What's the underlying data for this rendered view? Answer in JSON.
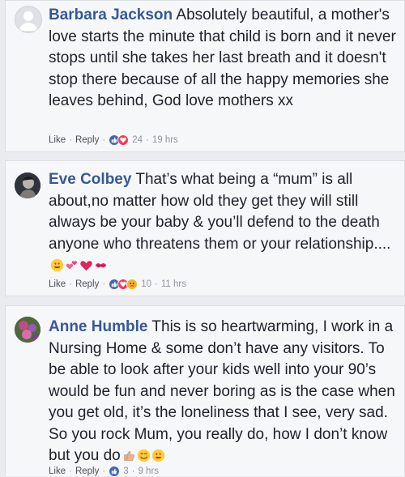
{
  "comments": [
    {
      "author": "Barbara Jackson",
      "text": "Absolutely beautiful, a mother's love starts the minute that child is born and it never stops until she takes her last breath and it doesn't stop there because of all the happy memories she leaves behind, God love mothers xx",
      "like": "Like",
      "reply": "Reply",
      "count": "24",
      "time": "19 hrs",
      "reactions": [
        "like-reaction-icon",
        "love-reaction-icon"
      ]
    },
    {
      "author": "Eve Colbey",
      "text": "That’s what being a “mum” is all about,no matter how old they get they will still always be your baby & you’ll defend to the death anyone who threatens them or your relationship....",
      "emojis": [
        "heart-eyes-emoji",
        "two-hearts-emoji",
        "red-heart-emoji",
        "kiss-mark-emoji"
      ],
      "like": "Like",
      "reply": "Reply",
      "count": "10",
      "time": "11 hrs",
      "reactions": [
        "like-reaction-icon",
        "love-reaction-icon",
        "sad-reaction-icon"
      ]
    },
    {
      "author": "Anne Humble",
      "text": "This is so heartwarming, I work in a Nursing Home & some don’t have any visitors. To be able to look after your kids well into your 90’s would be fun and never boring as is the case when you get old, it’s the loneliness that I see, very sad. So you rock Mum, you really do, how I don’t know but you do",
      "emojis": [
        "thumbs-up-emoji",
        "smiling-emoji",
        "heart-eyes-emoji"
      ],
      "like": "Like",
      "reply": "Reply",
      "count": "3",
      "time": "9 hrs",
      "reactions": [
        "like-reaction-icon"
      ]
    }
  ],
  "colors": {
    "name": "#365899",
    "text": "#1d2129",
    "meta": "#90949c",
    "like_blue": "#4267b2",
    "love_red": "#f33e58"
  }
}
